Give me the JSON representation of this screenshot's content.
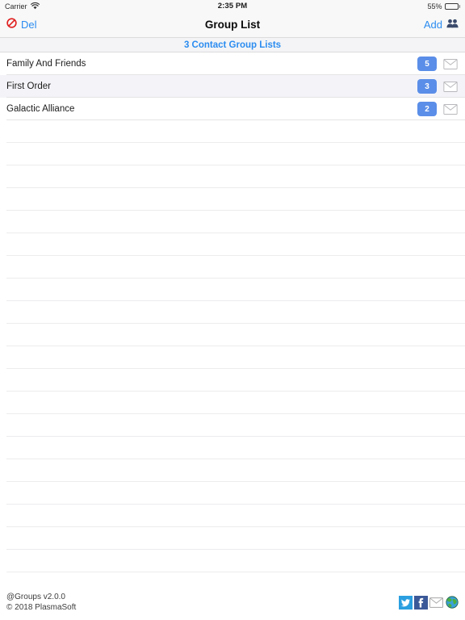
{
  "status_bar": {
    "carrier": "Carrier",
    "wifi_icon": "wifi-icon",
    "time": "2:35 PM",
    "battery_percent": "55%",
    "battery_level": 55,
    "battery_icon": "battery-icon"
  },
  "nav_bar": {
    "title": "Group List",
    "left_button": {
      "label": "Del",
      "icon": "prohibited-icon",
      "icon_color": "#e02020",
      "label_color": "#2b8cf0"
    },
    "right_button": {
      "label": "Add",
      "icon": "group-people-icon",
      "label_color": "#2b8cf0"
    }
  },
  "count_bar": {
    "text": "3 Contact Group Lists",
    "color": "#2b8cf0"
  },
  "list": {
    "columns": [
      "name",
      "count",
      "mail"
    ],
    "rows": [
      {
        "name": "Family And Friends",
        "count": "5",
        "mail_icon": "envelope-icon"
      },
      {
        "name": "First Order",
        "count": "3",
        "mail_icon": "envelope-icon"
      },
      {
        "name": "Galactic Alliance",
        "count": "2",
        "mail_icon": "envelope-icon"
      }
    ],
    "empty_row_count": 21,
    "badge_color": "#5b8ee8"
  },
  "footer": {
    "line1": "@Groups v2.0.0",
    "line2": "© 2018 PlasmaSoft",
    "icons": [
      {
        "name": "twitter-icon",
        "color": "#2b9fe0"
      },
      {
        "name": "facebook-icon",
        "color": "#3b5998"
      },
      {
        "name": "email-icon",
        "color": "#9a9a9a"
      },
      {
        "name": "globe-icon",
        "color": "#3a9b3a"
      }
    ]
  }
}
